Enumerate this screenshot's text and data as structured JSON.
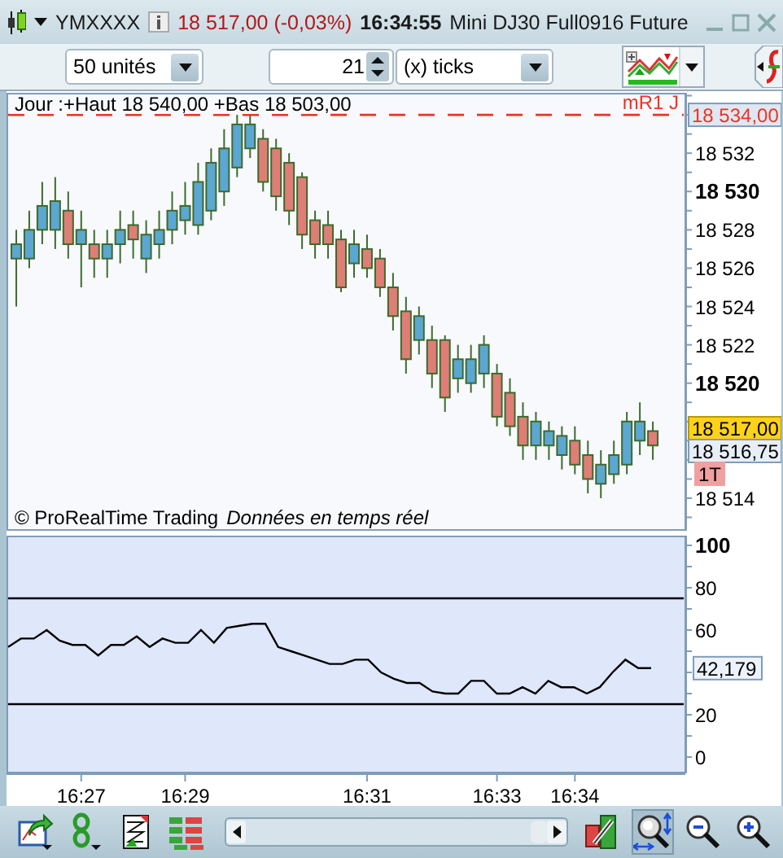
{
  "window": {
    "symbol": "YMXXXX",
    "price": "18 517,00 (-0,03%)",
    "time": "16:34:55",
    "description": "Mini DJ30 Full0916 Future"
  },
  "toolbar": {
    "units": "50 unités",
    "count": "21",
    "interval": "(x) ticks"
  },
  "price_chart": {
    "header": "Jour :+Haut 18 540,00 +Bas 18 503,00",
    "chart_data": {
      "type": "candlestick",
      "categories": [
        null,
        null,
        null,
        null,
        null,
        null,
        null,
        null,
        null,
        null,
        null,
        null,
        null,
        null,
        null,
        null,
        null,
        null,
        null,
        null,
        null,
        null,
        null,
        null,
        null,
        null,
        null,
        null,
        null,
        null,
        null,
        null,
        null,
        null,
        null,
        null,
        null,
        null,
        null,
        null,
        null,
        null,
        null,
        null,
        null,
        null,
        null,
        null,
        null,
        null
      ],
      "ohlc": [
        [
          18526.5,
          18528,
          18524,
          18527.25
        ],
        [
          18526.5,
          18529,
          18526,
          18528
        ],
        [
          18528,
          18530.5,
          18527.25,
          18529.25
        ],
        [
          18528,
          18530.75,
          18527,
          18529.5
        ],
        [
          18529,
          18530,
          18526.5,
          18527.25
        ],
        [
          18527.25,
          18529,
          18525,
          18528
        ],
        [
          18527.25,
          18528,
          18525.5,
          18526.5
        ],
        [
          18526.5,
          18528,
          18525.5,
          18527.25
        ],
        [
          18527.25,
          18529,
          18526.25,
          18528
        ],
        [
          18528.25,
          18529,
          18526.5,
          18527.5
        ],
        [
          18526.5,
          18528.5,
          18525.75,
          18527.75
        ],
        [
          18527.25,
          18529,
          18526.5,
          18528
        ],
        [
          18528,
          18530,
          18527.25,
          18529
        ],
        [
          18528.5,
          18530.5,
          18527.75,
          18529.25
        ],
        [
          18528.25,
          18531.5,
          18527.75,
          18530.5
        ],
        [
          18529,
          18532.25,
          18528.5,
          18531.5
        ],
        [
          18530,
          18533.25,
          18529.25,
          18532.25
        ],
        [
          18531.25,
          18534,
          18530.75,
          18533.5
        ],
        [
          18532.25,
          18534,
          18531.75,
          18533.5
        ],
        [
          18532.75,
          18533.25,
          18530,
          18530.5
        ],
        [
          18532.25,
          18532.75,
          18529,
          18529.75
        ],
        [
          18531.5,
          18532,
          18528.25,
          18529
        ],
        [
          18530.75,
          18531,
          18527,
          18527.75
        ],
        [
          18528.5,
          18529,
          18526.5,
          18527.25
        ],
        [
          18528.25,
          18529,
          18526.5,
          18527.25
        ],
        [
          18527.5,
          18528,
          18524.75,
          18525
        ],
        [
          18526.25,
          18528,
          18525.5,
          18527.25
        ],
        [
          18527,
          18527.75,
          18525.5,
          18526
        ],
        [
          18526.5,
          18527,
          18524.5,
          18525
        ],
        [
          18525,
          18525.75,
          18522.75,
          18523.5
        ],
        [
          18523.75,
          18524.5,
          18520.5,
          18521.25
        ],
        [
          18522.25,
          18524,
          18521.5,
          18523.5
        ],
        [
          18522.25,
          18523,
          18519.75,
          18520.5
        ],
        [
          18522.25,
          18522.5,
          18518.5,
          18519.25
        ],
        [
          18520.25,
          18522,
          18519.5,
          18521.25
        ],
        [
          18520,
          18522,
          18519.5,
          18521.25
        ],
        [
          18520.5,
          18522.5,
          18519.75,
          18522
        ],
        [
          18520.5,
          18521,
          18517.75,
          18518.25
        ],
        [
          18519.5,
          18520.25,
          18517.25,
          18517.75
        ],
        [
          18518.25,
          18519,
          18516,
          18516.75
        ],
        [
          18516.75,
          18518.5,
          18516,
          18518
        ],
        [
          18516.75,
          18518,
          18516,
          18517.5
        ],
        [
          18516.25,
          18517.75,
          18515.5,
          18517.25
        ],
        [
          18517,
          18517.75,
          18515.25,
          18515.75
        ],
        [
          18516.25,
          18517,
          18514.25,
          18515
        ],
        [
          18514.75,
          18516.5,
          18514,
          18515.75
        ],
        [
          18515.25,
          18517,
          18514.75,
          18516.25
        ],
        [
          18515.75,
          18518.5,
          18515.25,
          18518
        ],
        [
          18517,
          18519,
          18516.25,
          18518
        ],
        [
          18517.5,
          18518,
          18516,
          18516.75
        ]
      ],
      "ylim": [
        18512.3,
        18535.15
      ],
      "yticks": [
        {
          "value": 18532,
          "label": "18 532"
        },
        {
          "value": 18530,
          "label": "18 530"
        },
        {
          "value": 18528,
          "label": "18 528"
        },
        {
          "value": 18526,
          "label": "18 526"
        },
        {
          "value": 18524,
          "label": "18 524"
        },
        {
          "value": 18522,
          "label": "18 522"
        },
        {
          "value": 18520,
          "label": "18 520"
        },
        {
          "value": 18514,
          "label": "18 514"
        }
      ],
      "ref_lines": [
        {
          "axis": "y",
          "value": 18534,
          "label": "mR1 J"
        }
      ]
    },
    "markers": [
      {
        "text": "18 534,00",
        "kind": "reference"
      },
      {
        "text": "18 517,00",
        "kind": "last"
      },
      {
        "text": "18 516,75",
        "kind": "cursor"
      },
      {
        "text": "1T",
        "kind": "interval"
      }
    ],
    "copyright": "© ProRealTime Trading",
    "realtime_note": "Données en temps réel"
  },
  "indicator": {
    "reading": "42,179",
    "chart_data": {
      "type": "line",
      "ylim": [
        -6.9,
        104.6
      ],
      "yticks": [
        0,
        20,
        60,
        80,
        100
      ],
      "ref_lines": [
        {
          "axis": "y",
          "value": 75
        },
        {
          "axis": "y",
          "value": 25
        }
      ],
      "categories": [
        null,
        null,
        null,
        null,
        null,
        null,
        null,
        null,
        null,
        null,
        null,
        null,
        null,
        null,
        null,
        null,
        null,
        null,
        null,
        null,
        null,
        null,
        null,
        null,
        null,
        null,
        null,
        null,
        null,
        null,
        null,
        null,
        null,
        null,
        null,
        null,
        null,
        null,
        null,
        null,
        null,
        null,
        null,
        null,
        null,
        null,
        null,
        null,
        null,
        null,
        null
      ],
      "series": [
        {
          "color": "#000000",
          "values": [
            52,
            56,
            56,
            60,
            55,
            53,
            53,
            48,
            53,
            53,
            57,
            52,
            56,
            54,
            54,
            60,
            54,
            61,
            62,
            63,
            63,
            52,
            50,
            48,
            46,
            44,
            44,
            46,
            46,
            40,
            37,
            35,
            35,
            31,
            30,
            30,
            36,
            36,
            30,
            30,
            33,
            30,
            36,
            33,
            33,
            30,
            33,
            40,
            46,
            42,
            42
          ]
        }
      ]
    }
  },
  "time_axis": [
    "16:27",
    "16:29",
    "16:31",
    "16:33",
    "16:34"
  ],
  "bottom_toolbar": [
    {
      "kind": "export",
      "selected": false
    },
    {
      "kind": "link",
      "selected": false
    },
    {
      "kind": "document",
      "selected": false
    },
    {
      "kind": "bricks",
      "selected": false
    },
    {
      "kind": "scrollbar"
    },
    {
      "kind": "wrench",
      "selected": false
    },
    {
      "kind": "zoom-fit",
      "selected": true
    },
    {
      "kind": "zoom-out",
      "selected": false
    },
    {
      "kind": "zoom-in",
      "selected": false
    }
  ]
}
